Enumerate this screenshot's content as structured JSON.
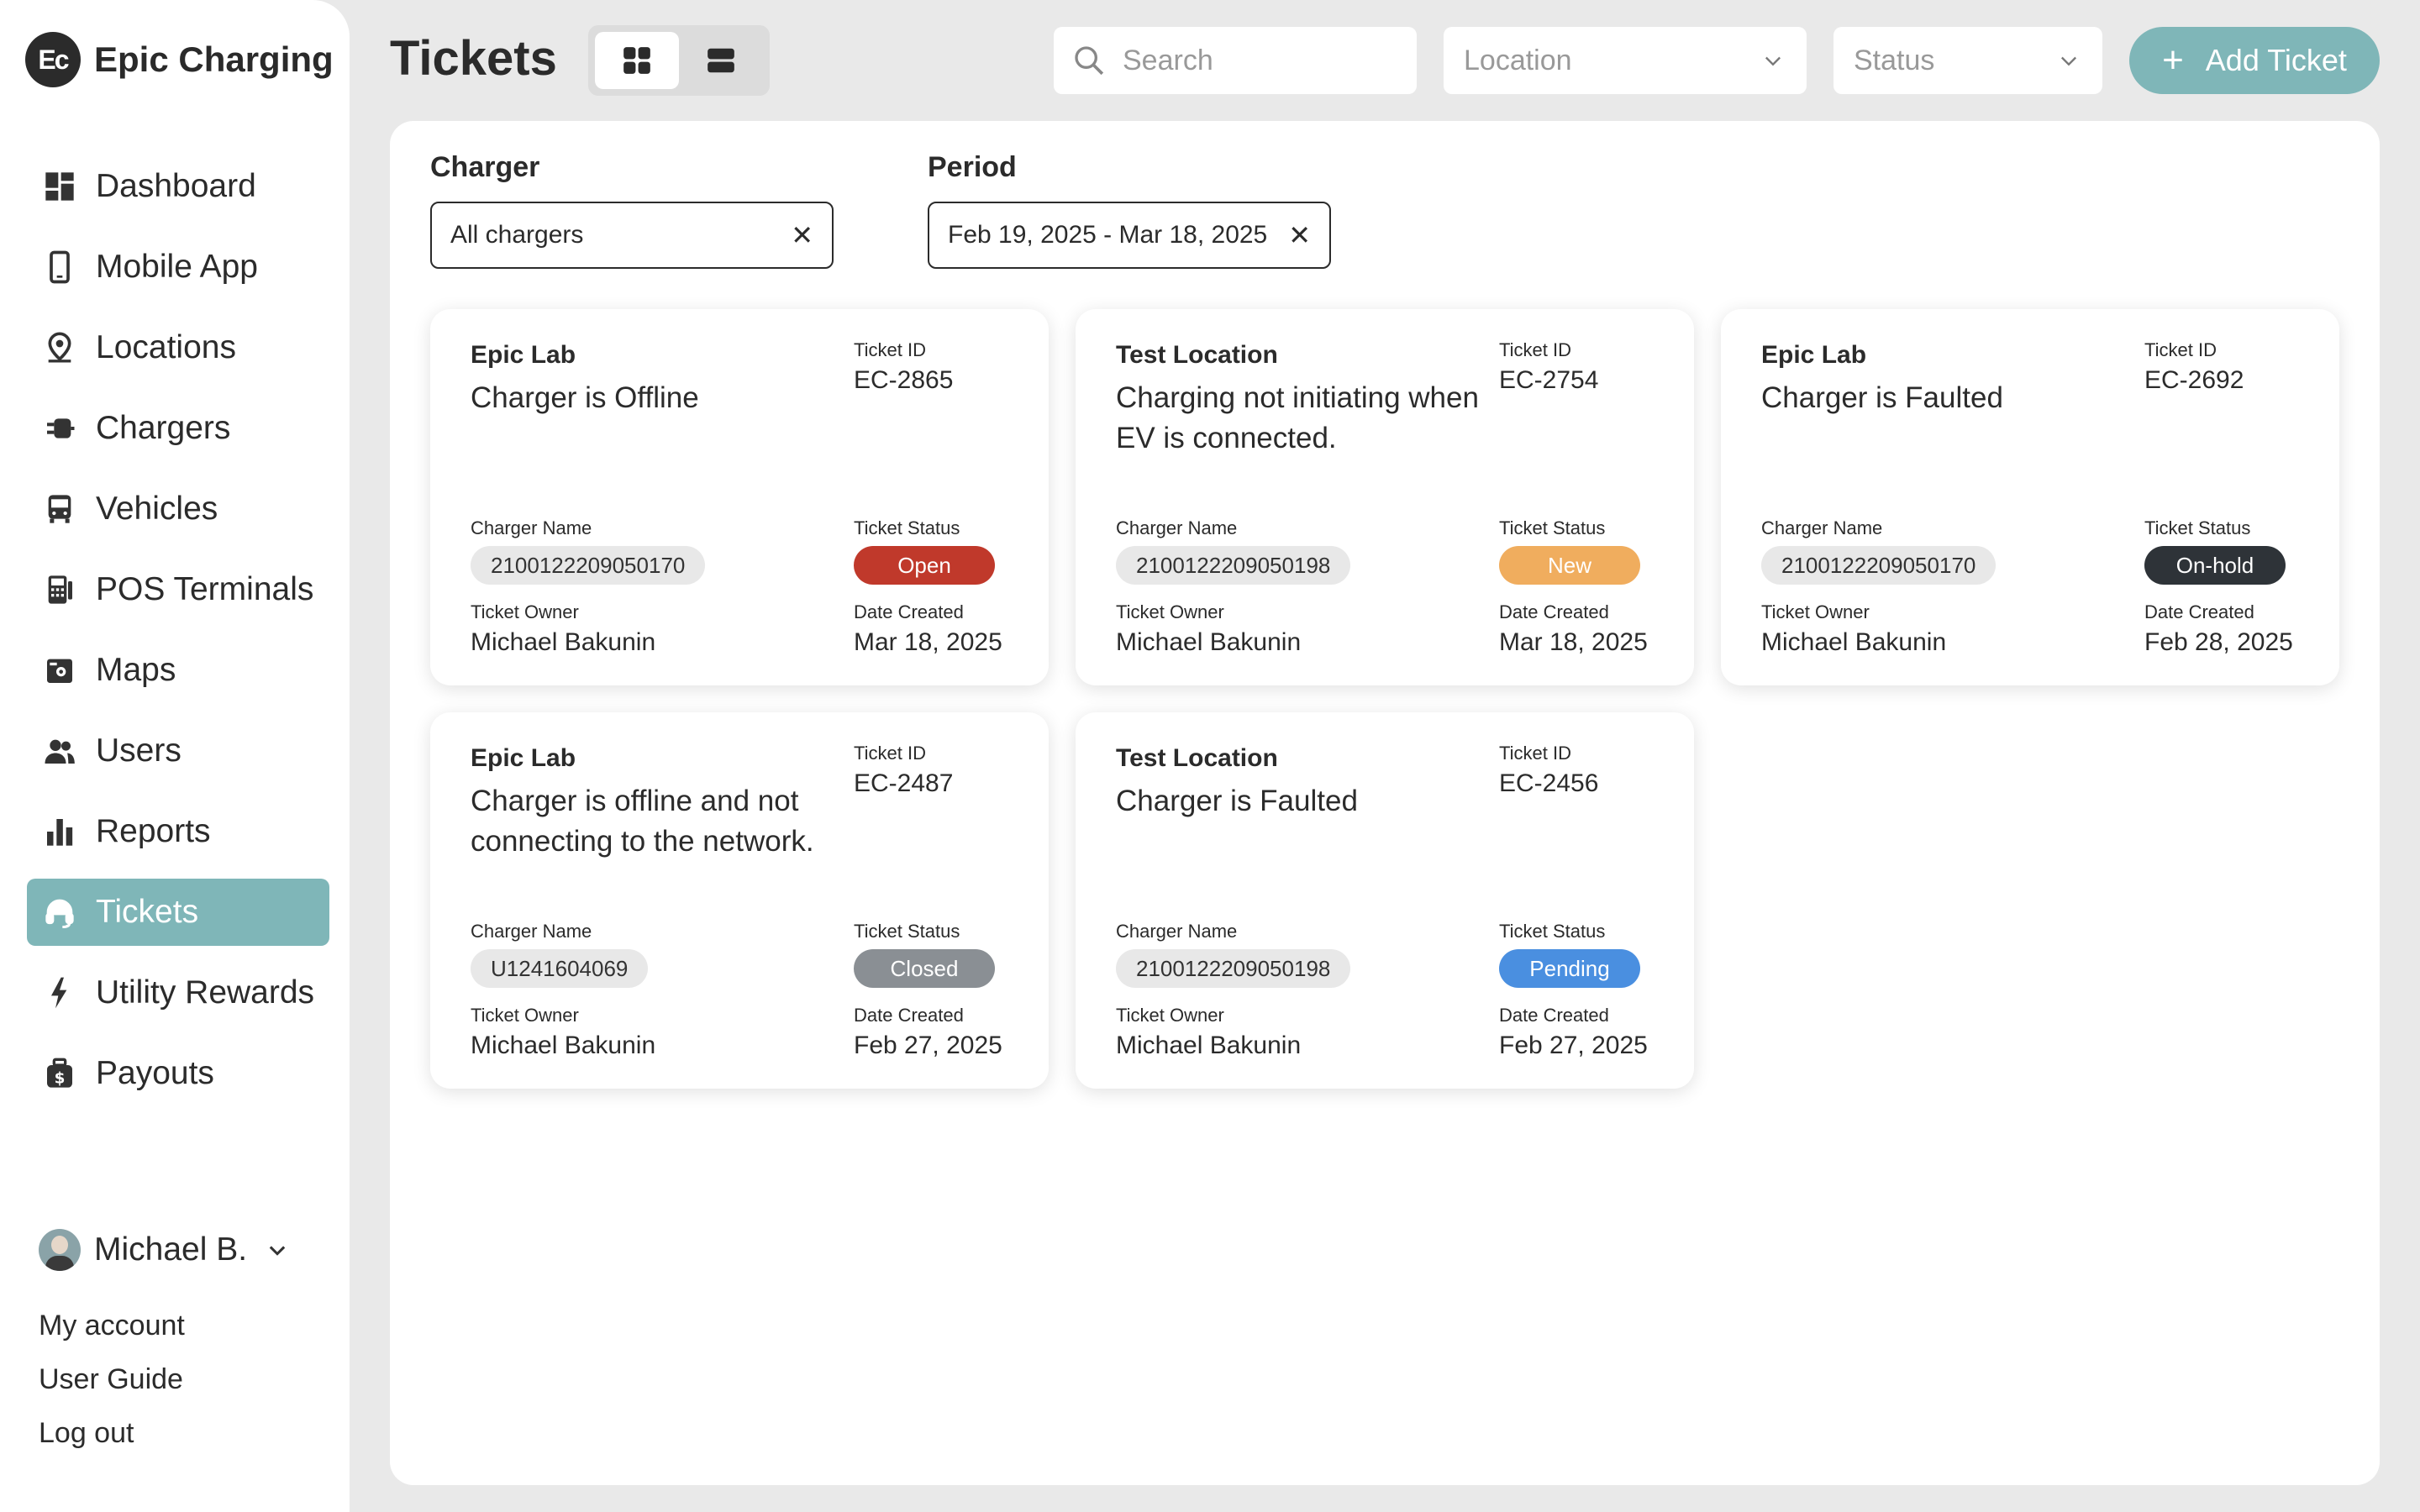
{
  "brand": {
    "logo_text": "Ec",
    "name": "Epic Charging"
  },
  "nav": [
    {
      "label": "Dashboard",
      "icon": "dashboard-icon"
    },
    {
      "label": "Mobile App",
      "icon": "mobile-icon"
    },
    {
      "label": "Locations",
      "icon": "location-pin-icon"
    },
    {
      "label": "Chargers",
      "icon": "charger-plug-icon"
    },
    {
      "label": "Vehicles",
      "icon": "bus-icon"
    },
    {
      "label": "POS Terminals",
      "icon": "pos-terminal-icon"
    },
    {
      "label": "Maps",
      "icon": "map-icon"
    },
    {
      "label": "Users",
      "icon": "users-icon"
    },
    {
      "label": "Reports",
      "icon": "bar-chart-icon"
    },
    {
      "label": "Tickets",
      "icon": "headset-icon",
      "active": true
    },
    {
      "label": "Utility Rewards",
      "icon": "lightning-icon"
    },
    {
      "label": "Payouts",
      "icon": "money-bag-icon"
    }
  ],
  "user": {
    "name": "Michael B.",
    "links": [
      "My account",
      "User Guide",
      "Log out"
    ]
  },
  "header": {
    "title": "Tickets",
    "search_placeholder": "Search",
    "location_placeholder": "Location",
    "status_placeholder": "Status",
    "add_label": "Add Ticket"
  },
  "filters": {
    "charger_label": "Charger",
    "charger_value": "All chargers",
    "period_label": "Period",
    "period_value": "Feb 19, 2025 - Mar 18, 2025"
  },
  "field_labels": {
    "ticket_id": "Ticket ID",
    "charger_name": "Charger Name",
    "ticket_status": "Ticket Status",
    "ticket_owner": "Ticket Owner",
    "date_created": "Date Created"
  },
  "colors": {
    "accent": "#7fb6b8",
    "status_open": "#c0392b",
    "status_new": "#f0ad5e",
    "status_onhold": "#2e3338",
    "status_closed": "#8a8f94",
    "status_pending": "#4a8fe0"
  },
  "tickets": [
    {
      "location": "Epic Lab",
      "title": "Charger is Offline",
      "id": "EC-2865",
      "charger": "2100122209050170",
      "status": "Open",
      "owner": "Michael Bakunin",
      "date": "Mar 18, 2025"
    },
    {
      "location": "Test Location",
      "title": "Charging not initiating when EV is connected.",
      "id": "EC-2754",
      "charger": "2100122209050198",
      "status": "New",
      "owner": "Michael Bakunin",
      "date": "Mar 18, 2025"
    },
    {
      "location": "Epic Lab",
      "title": "Charger is Faulted",
      "id": "EC-2692",
      "charger": "2100122209050170",
      "status": "On-hold",
      "owner": "Michael Bakunin",
      "date": "Feb 28, 2025"
    },
    {
      "location": "Epic Lab",
      "title": "Charger is offline and not connecting to the network.",
      "id": "EC-2487",
      "charger": "U1241604069",
      "status": "Closed",
      "owner": "Michael Bakunin",
      "date": "Feb 27, 2025"
    },
    {
      "location": "Test Location",
      "title": "Charger is Faulted",
      "id": "EC-2456",
      "charger": "2100122209050198",
      "status": "Pending",
      "owner": "Michael Bakunin",
      "date": "Feb 27, 2025"
    }
  ]
}
